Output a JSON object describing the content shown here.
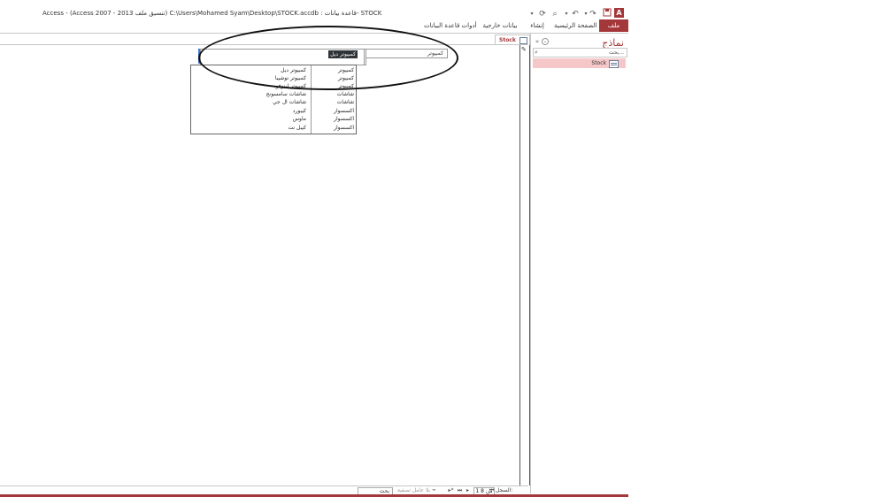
{
  "window": {
    "title": "Access - (Access 2007 - 2013 تنسيق ملف) C:\\Users\\Mohamed Syam\\Desktop\\STOCK.accdb : قاعدة بيانات- STOCK",
    "logo": "A"
  },
  "qat": {
    "save_icon": "save-icon",
    "undo": "↶",
    "redo": "↷",
    "print_preview": "⌕",
    "qat_more": "▾",
    "sync": "⟳"
  },
  "ribbon": {
    "file": "ملف",
    "tabs": [
      "الصفحة الرئيسية",
      "إنشاء",
      "بيانات خارجية",
      "أدوات قاعدة البيانات"
    ]
  },
  "nav_pane": {
    "title": "نماذج",
    "search_placeholder": "بحث...",
    "items": [
      {
        "label": "Stock"
      }
    ]
  },
  "document": {
    "tab_label": "Stock",
    "combo_label": "كمبيوتر",
    "combo_selected": "كمبيوتر ديل",
    "combo_arrow": "⌄",
    "dropdown_rows": [
      {
        "category": "كمبيوتر",
        "item": "كمبيوتر ديل"
      },
      {
        "category": "كمبيوتر",
        "item": "كمبيوتر توشيبا"
      },
      {
        "category": "كمبيوتر",
        "item": "كمبيوتر لينوفو"
      },
      {
        "category": "شاشات",
        "item": "شاشات سامسونج"
      },
      {
        "category": "شاشات",
        "item": "شاشات ال جي"
      },
      {
        "category": "اكسسوار",
        "item": "كيبورد"
      },
      {
        "category": "اكسسوار",
        "item": "ماوس"
      },
      {
        "category": "اكسسوار",
        "item": "كيبل نت"
      }
    ]
  },
  "status_bar": {
    "record_label": "السجل:",
    "record_value": "1 من 8",
    "filter_label": "بلا عامل تصفية",
    "search_label": "بحث"
  },
  "colors": {
    "accent": "#a4373a",
    "selected_nav": "#f6c7c9",
    "selected_text_bg": "#2f3439"
  }
}
